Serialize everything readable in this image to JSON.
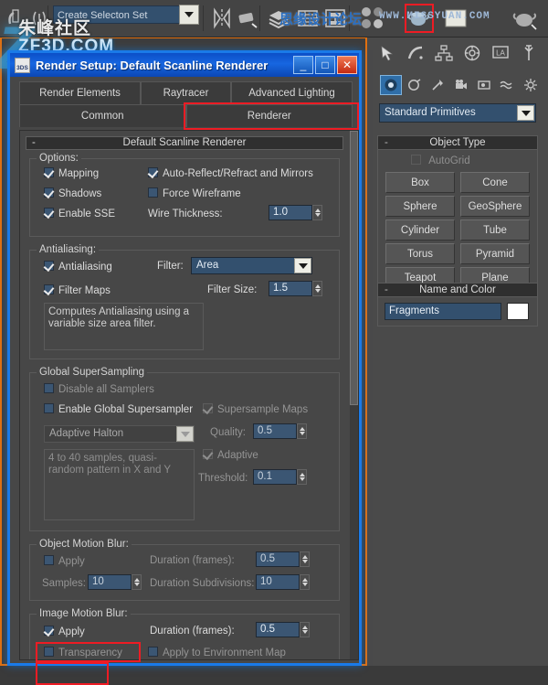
{
  "toolbar": {
    "selection_set_value": "Create Selecton Set",
    "icons": [
      "snap-toggle-icon",
      "angle-snap-icon",
      "percent-snap-icon",
      "spinner-snap-icon",
      "mirror-icon",
      "align-icon",
      "layer-manager-icon",
      "curve-editor-icon",
      "schematic-view-icon",
      "material-editor-icon",
      "render-setup-icon",
      "render-frame-window-icon",
      "render-production-icon"
    ],
    "watermarks": {
      "zf_cn": "朱峰社区",
      "zf_url": "ZF3D.COM",
      "zf_glyph": "Z",
      "siyuan_cn": "思缘设计论坛",
      "siyuan_url": "WWW.MISSYUAN.COM"
    }
  },
  "command_panel": {
    "tabs": [
      "create-tab",
      "modify-tab",
      "hierarchy-tab",
      "motion-tab",
      "display-tab",
      "utilities-tab"
    ],
    "subtabs": [
      "geometry-icon",
      "shapes-icon",
      "lights-icon",
      "cameras-icon",
      "helpers-icon",
      "space-warps-icon",
      "systems-icon"
    ],
    "category_value": "Standard Primitives",
    "object_type": {
      "title": "Object Type",
      "autogrid_label": "AutoGrid",
      "autogrid_checked": false,
      "buttons": [
        "Box",
        "Cone",
        "Sphere",
        "GeoSphere",
        "Cylinder",
        "Tube",
        "Torus",
        "Pyramid",
        "Teapot",
        "Plane"
      ]
    },
    "name_and_color": {
      "title": "Name and Color",
      "name_value": "Fragments",
      "color": "#ffffff"
    }
  },
  "dialog": {
    "title": "Render Setup: Default Scanline Renderer",
    "window_buttons": {
      "minimize": "_",
      "maximize": "□",
      "close": "✕"
    },
    "tabs_row1": [
      "Render Elements",
      "Raytracer",
      "Advanced Lighting"
    ],
    "tabs_row2": [
      "Common",
      "Renderer"
    ],
    "active_tab": "Renderer",
    "rollout_title": "Default Scanline Renderer",
    "options": {
      "group_label": "Options:",
      "mapping": {
        "label": "Mapping",
        "checked": true
      },
      "shadows": {
        "label": "Shadows",
        "checked": true
      },
      "enable_sse": {
        "label": "Enable SSE",
        "checked": true
      },
      "auto_reflect": {
        "label": "Auto-Reflect/Refract and Mirrors",
        "checked": true
      },
      "force_wireframe": {
        "label": "Force Wireframe",
        "checked": false
      },
      "wire_thickness_label": "Wire Thickness:",
      "wire_thickness_value": "1.0"
    },
    "antialiasing": {
      "group_label": "Antialiasing:",
      "antialiasing": {
        "label": "Antialiasing",
        "checked": true
      },
      "filter_maps": {
        "label": "Filter Maps",
        "checked": true
      },
      "filter_label": "Filter:",
      "filter_value": "Area",
      "filter_size_label": "Filter Size:",
      "filter_size_value": "1.5",
      "description": "Computes Antialiasing using a variable size area filter."
    },
    "supersampling": {
      "group_label": "Global SuperSampling",
      "disable_all": {
        "label": "Disable all Samplers",
        "checked": false
      },
      "enable_global": {
        "label": "Enable Global Supersampler",
        "checked": false
      },
      "sampler_value": "Adaptive Halton",
      "sampler_description": "4 to 40 samples, quasi-random pattern in X and Y",
      "supersample_maps": {
        "label": "Supersample Maps",
        "checked": true
      },
      "quality_label": "Quality:",
      "quality_value": "0.5",
      "adaptive": {
        "label": "Adaptive",
        "checked": true
      },
      "threshold_label": "Threshold:",
      "threshold_value": "0.1"
    },
    "object_motion_blur": {
      "group_label": "Object Motion Blur:",
      "apply": {
        "label": "Apply",
        "checked": false
      },
      "duration_label": "Duration (frames):",
      "duration_value": "0.5",
      "samples_label": "Samples:",
      "samples_value": "10",
      "subdivisions_label": "Duration Subdivisions:",
      "subdivisions_value": "10"
    },
    "image_motion_blur": {
      "group_label": "Image Motion Blur:",
      "apply": {
        "label": "Apply",
        "checked": true
      },
      "duration_label": "Duration (frames):",
      "duration_value": "0.5",
      "transparency": {
        "label": "Transparency",
        "checked": false
      },
      "apply_env_map": {
        "label": "Apply to Environment Map",
        "checked": false
      }
    }
  },
  "annotations": {
    "highlight_color": "#ee1c24",
    "items": [
      "renderer-tab-highlight",
      "image-motion-blur-label-highlight",
      "image-motion-blur-apply-highlight",
      "toolbar-render-highlight"
    ]
  }
}
